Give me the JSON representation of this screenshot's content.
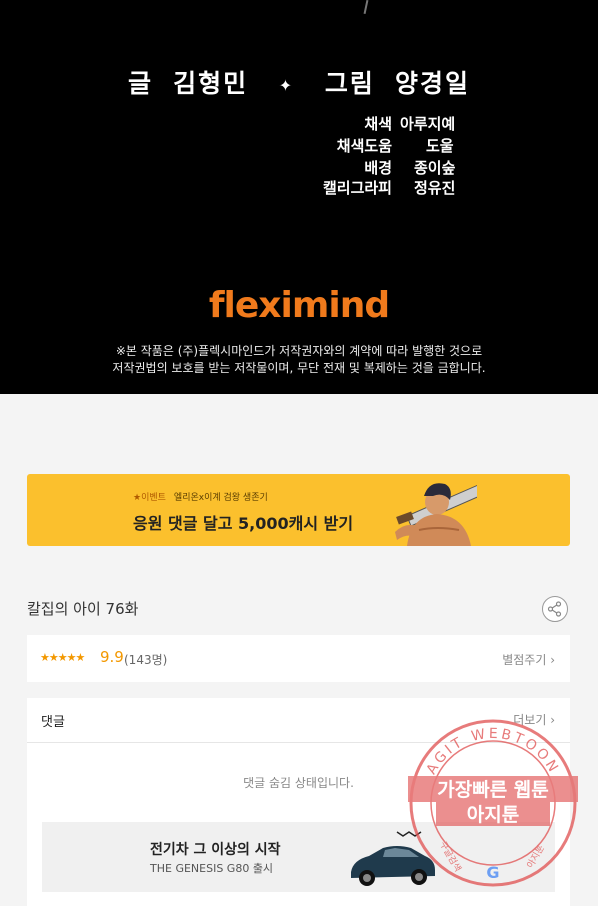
{
  "credits": {
    "writer_role": "글",
    "writer_name": "김형민",
    "separator": "✦",
    "artist_role": "그림",
    "artist_name": "양경일",
    "crew": [
      {
        "role": "채색",
        "name": "아루지예"
      },
      {
        "role": "채색도움",
        "name": "도울"
      },
      {
        "role": "배경",
        "name": "종이숲"
      },
      {
        "role": "캘리그라피",
        "name": "정유진"
      }
    ],
    "logo": "fleximind",
    "notice_line1": "※본 작품은 (주)플렉시마인드가 저작권자와의 계약에 따라 발행한 것으로",
    "notice_line2": "저작권법의 보호를 받는 저작물이며, 무단 전재 및 복제하는 것을 금합니다."
  },
  "banner": {
    "event_tag": "★이벤트",
    "event_name": "엘리온x이계 검왕 생존기",
    "headline": "응원 댓글 달고 5,000캐시 받기",
    "bg_color": "#fbc02d"
  },
  "episode": {
    "title": "칼집의 아이 76화",
    "share_icon": "share-icon"
  },
  "rating": {
    "stars": "★★★★★",
    "score": "9.9",
    "count": "(143명)",
    "rate_button": "별점주기 ›",
    "accent": "#f39800"
  },
  "comments": {
    "label": "댓글",
    "more": "더보기 ›",
    "hidden_message": "댓글 숨김 상태입니다."
  },
  "ad": {
    "title": "전기차 그 이상의 시작",
    "subtitle": "THE GENESIS G80 출시"
  },
  "watermark": {
    "ring_text": "AGIT WEBTOON",
    "line1": "가장빠른 웹툰",
    "line2": "아지툰",
    "bottom_left": "구글검색",
    "bottom_right": "아지툰",
    "color": "#e05050"
  }
}
